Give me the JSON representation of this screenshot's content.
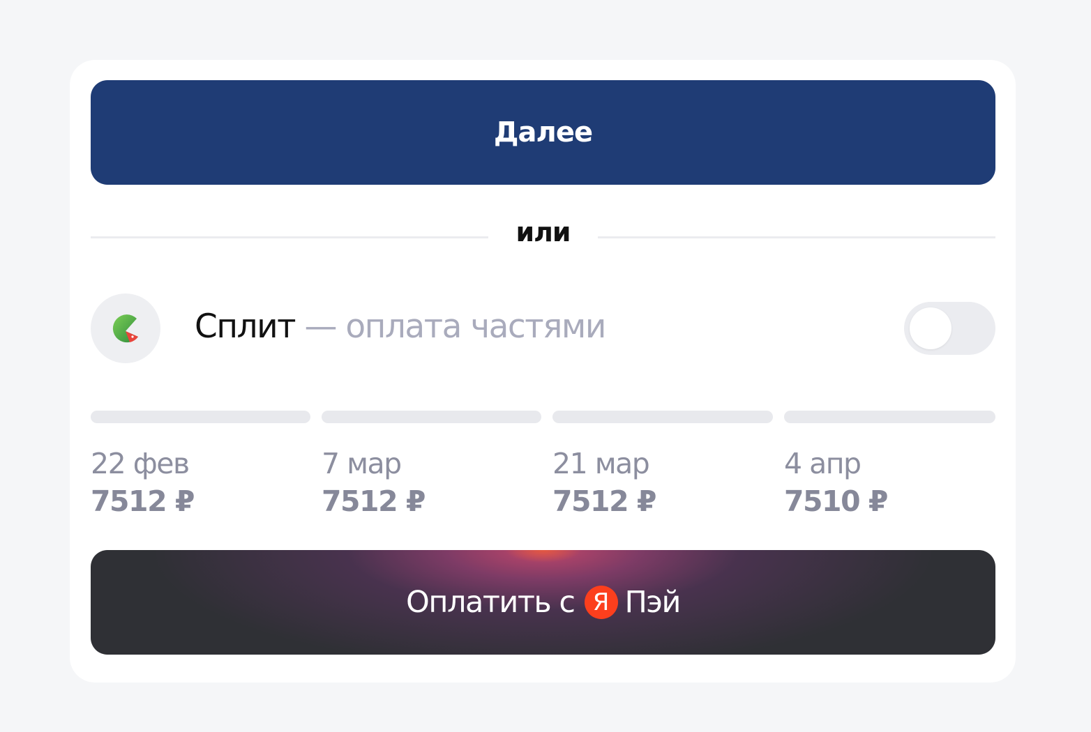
{
  "primary_button": {
    "label": "Далее"
  },
  "divider": {
    "label": "или"
  },
  "split": {
    "title": "Сплит",
    "subtitle": "— оплата частями",
    "icon": "split-logo-icon",
    "toggle_on": false
  },
  "installments": [
    {
      "date": "22 фев",
      "amount": "7512 ₽"
    },
    {
      "date": "7 мар",
      "amount": "7512 ₽"
    },
    {
      "date": "21 мар",
      "amount": "7512 ₽"
    },
    {
      "date": "4 апр",
      "amount": "7510 ₽"
    }
  ],
  "pay_button": {
    "prefix": "Оплатить с",
    "logo_letter": "Я",
    "suffix": "Пэй"
  },
  "colors": {
    "primary": "#1f3c75",
    "pay_button": "#2f3035",
    "yandex_red": "#fc3f1d",
    "split_green": "#4caf50"
  }
}
